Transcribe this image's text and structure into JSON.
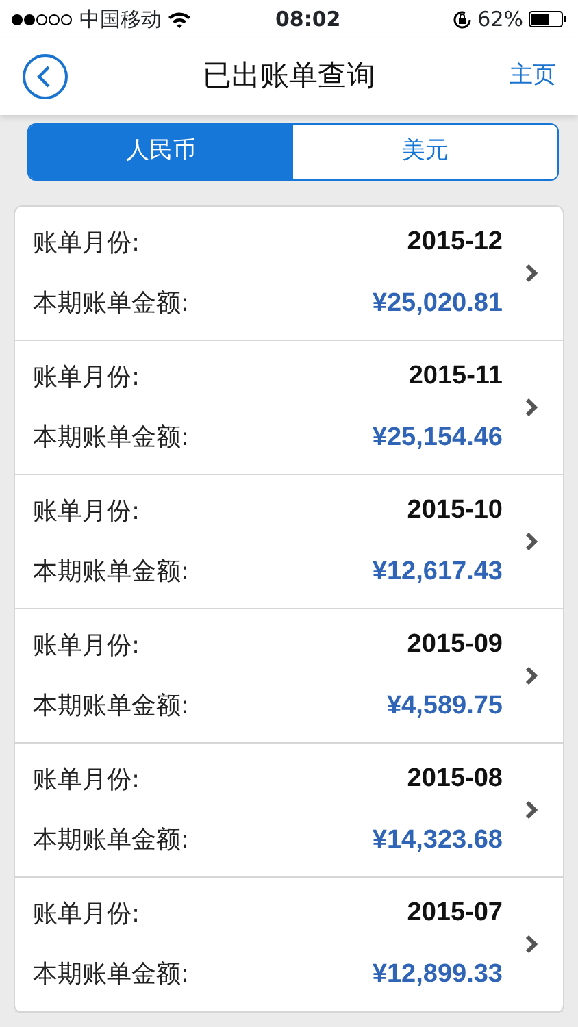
{
  "status_bar": {
    "carrier": "中国移动",
    "time": "08:02",
    "battery": "62%"
  },
  "nav": {
    "title": "已出账单查询",
    "home": "主页"
  },
  "tabs": [
    {
      "label": "人民币",
      "selected": true
    },
    {
      "label": "美元",
      "selected": false
    }
  ],
  "bills": [
    {
      "month_label": "账单月份:",
      "month": "2015-12",
      "amount_label": "本期账单金额:",
      "amount": "¥25,020.81"
    },
    {
      "month_label": "账单月份:",
      "month": "2015-11",
      "amount_label": "本期账单金额:",
      "amount": "¥25,154.46"
    },
    {
      "month_label": "账单月份:",
      "month": "2015-10",
      "amount_label": "本期账单金额:",
      "amount": "¥12,617.43"
    },
    {
      "month_label": "账单月份:",
      "month": "2015-09",
      "amount_label": "本期账单金额:",
      "amount": "¥4,589.75"
    },
    {
      "month_label": "账单月份:",
      "month": "2015-08",
      "amount_label": "本期账单金额:",
      "amount": "¥14,323.68"
    },
    {
      "month_label": "账单月份:",
      "month": "2015-07",
      "amount_label": "本期账单金额:",
      "amount": "¥12,899.33"
    }
  ]
}
